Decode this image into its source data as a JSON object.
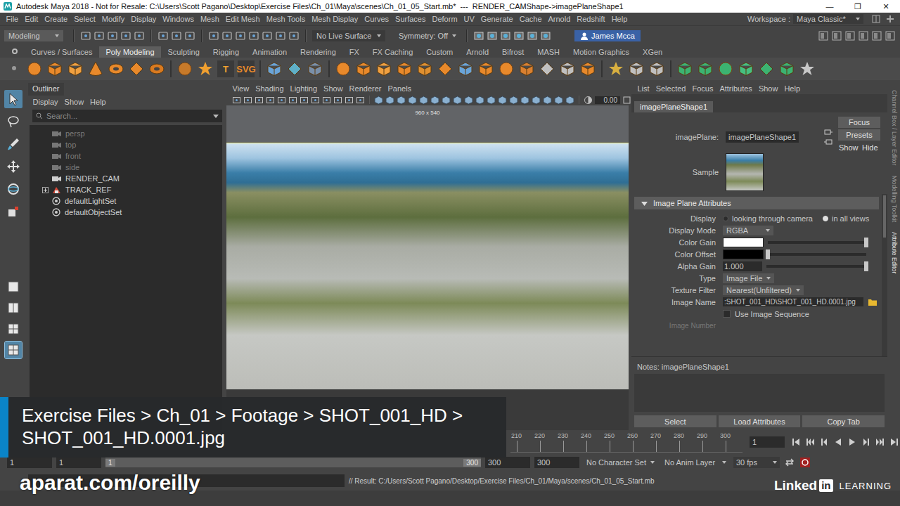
{
  "window": {
    "title": "Autodesk Maya 2018 - Not for Resale: C:\\Users\\Scott Pagano\\Desktop\\Exercise Files\\Ch_01\\Maya\\scenes\\Ch_01_05_Start.mb*  ---  RENDER_CAMShape->imagePlaneShape1",
    "controls": [
      "—",
      "❐",
      "✕"
    ]
  },
  "menu": [
    "File",
    "Edit",
    "Create",
    "Select",
    "Modify",
    "Display",
    "Windows",
    "Mesh",
    "Edit Mesh",
    "Mesh Tools",
    "Mesh Display",
    "Curves",
    "Surfaces",
    "Deform",
    "UV",
    "Generate",
    "Cache",
    "Arnold",
    "Redshift",
    "Help"
  ],
  "workspace": {
    "label": "Workspace :",
    "value": "Maya Classic*"
  },
  "status_line": {
    "mode": "Modeling",
    "live_surface": "No Live Surface",
    "symmetry": "Symmetry: Off",
    "user": "James Mcca"
  },
  "shelf": {
    "tabs": [
      {
        "label": "Curves / Surfaces",
        "selected": false
      },
      {
        "label": "Poly Modeling",
        "selected": true
      },
      {
        "label": "Sculpting",
        "selected": false
      },
      {
        "label": "Rigging",
        "selected": false
      },
      {
        "label": "Animation",
        "selected": false
      },
      {
        "label": "Rendering",
        "selected": false
      },
      {
        "label": "FX",
        "selected": false
      },
      {
        "label": "FX Caching",
        "selected": false
      },
      {
        "label": "Custom",
        "selected": false
      },
      {
        "label": "Arnold",
        "selected": false
      },
      {
        "label": "Bifrost",
        "selected": false
      },
      {
        "label": "MASH",
        "selected": false
      },
      {
        "label": "Motion Graphics",
        "selected": false
      },
      {
        "label": "XGen",
        "selected": false
      }
    ],
    "glyph_icons": [
      "T",
      "SVG"
    ]
  },
  "toolbox": {
    "tools": [
      {
        "selected": true
      },
      {
        "selected": false
      },
      {
        "selected": false
      },
      {
        "selected": false
      },
      {
        "selected": false
      },
      {
        "selected": false
      }
    ],
    "layouts": [
      {
        "selected": false
      },
      {
        "selected": false
      },
      {
        "selected": false
      },
      {
        "selected": true
      }
    ]
  },
  "outliner": {
    "title": "Outliner",
    "menu": [
      "Display",
      "Show",
      "Help"
    ],
    "search": {
      "placeholder": "Search..."
    },
    "items": [
      {
        "label": "persp",
        "kind": "camera",
        "dimmed": true,
        "expandable": false,
        "expanded": false
      },
      {
        "label": "top",
        "kind": "camera",
        "dimmed": true,
        "expandable": false,
        "expanded": false
      },
      {
        "label": "front",
        "kind": "camera",
        "dimmed": true,
        "expandable": false,
        "expanded": false
      },
      {
        "label": "side",
        "kind": "camera",
        "dimmed": true,
        "expandable": false,
        "expanded": false
      },
      {
        "label": "RENDER_CAM",
        "kind": "camera",
        "dimmed": false,
        "expandable": false,
        "expanded": false
      },
      {
        "label": "TRACK_REF",
        "kind": "transform",
        "dimmed": false,
        "expandable": true,
        "expanded": false
      },
      {
        "label": "defaultLightSet",
        "kind": "set",
        "dimmed": false,
        "expandable": false,
        "expanded": false
      },
      {
        "label": "defaultObjectSet",
        "kind": "set",
        "dimmed": false,
        "expandable": false,
        "expanded": false
      }
    ]
  },
  "viewport": {
    "menu": [
      "View",
      "Shading",
      "Lighting",
      "Show",
      "Renderer",
      "Panels"
    ],
    "resolution": "960 x 540",
    "exposure": "0.00"
  },
  "attribute_editor": {
    "menu": [
      "List",
      "Selected",
      "Focus",
      "Attributes",
      "Show",
      "Help"
    ],
    "tab": "imagePlaneShape1",
    "node_label": "imagePlane:",
    "node_value": "imagePlaneShape1",
    "buttons": [
      "Focus",
      "Presets",
      "Show",
      "Hide"
    ],
    "sample_label": "Sample",
    "section": {
      "title": "Image Plane Attributes",
      "expanded": true
    },
    "rows": [
      {
        "kind": "radio",
        "label": "Display",
        "options": [
          {
            "label": "looking through camera",
            "selected": false
          },
          {
            "label": "in all views",
            "selected": true
          }
        ]
      },
      {
        "kind": "dropdown",
        "label": "Display Mode",
        "value": "RGBA"
      },
      {
        "kind": "color",
        "label": "Color Gain",
        "color": "#ffffff",
        "level": 1.0
      },
      {
        "kind": "color",
        "label": "Color Offset",
        "color": "#000000",
        "level": 0.0
      },
      {
        "kind": "number",
        "label": "Alpha Gain",
        "value": "1.000",
        "level": 1.0
      },
      {
        "kind": "dropdown",
        "label": "Type",
        "value": "Image File"
      },
      {
        "kind": "dropdown",
        "label": "Texture Filter",
        "value": "Nearest(Unfiltered)"
      },
      {
        "kind": "file",
        "label": "Image Name",
        "value": ":SHOT_001_HD\\SHOT_001_HD.0001.jpg"
      },
      {
        "kind": "checkbox",
        "label": "Use Image Sequence",
        "checked": false
      },
      {
        "kind": "cut",
        "label": "Image Number"
      }
    ],
    "notes_label": "Notes: imagePlaneShape1",
    "bottom_buttons": [
      "Select",
      "Load Attributes",
      "Copy Tab"
    ]
  },
  "side_tabs": [
    {
      "label": "Channel Box / Layer Editor",
      "selected": false
    },
    {
      "label": "Modelling Toolkit",
      "selected": false
    },
    {
      "label": "Attribute Editor",
      "selected": true
    }
  ],
  "time_slider": {
    "ticks": [
      "210",
      "220",
      "230",
      "240",
      "250",
      "260",
      "270",
      "280",
      "290",
      "300"
    ],
    "current_frame": "1"
  },
  "range_slider": {
    "start_outer": "1",
    "start_inner": "1",
    "handle_start": "1",
    "handle_end": "300",
    "end_inner": "300",
    "end_outer": "300",
    "character_set": "No Character Set",
    "anim_layer": "No Anim Layer",
    "fps": "30 fps"
  },
  "command_line": {
    "result": "// Result: C:/Users/Scott Pagano/Desktop/Exercise Files/Ch_01/Maya/scenes/Ch_01_05_Start.mb"
  },
  "overlays": {
    "caption": "Exercise Files > Ch_01 > Footage > SHOT_001_HD > SHOT_001_HD.0001.jpg",
    "watermark": "aparat.com/oreilly",
    "logo": {
      "word": "Linked",
      "box": "in",
      "sub": "LEARNING"
    }
  }
}
